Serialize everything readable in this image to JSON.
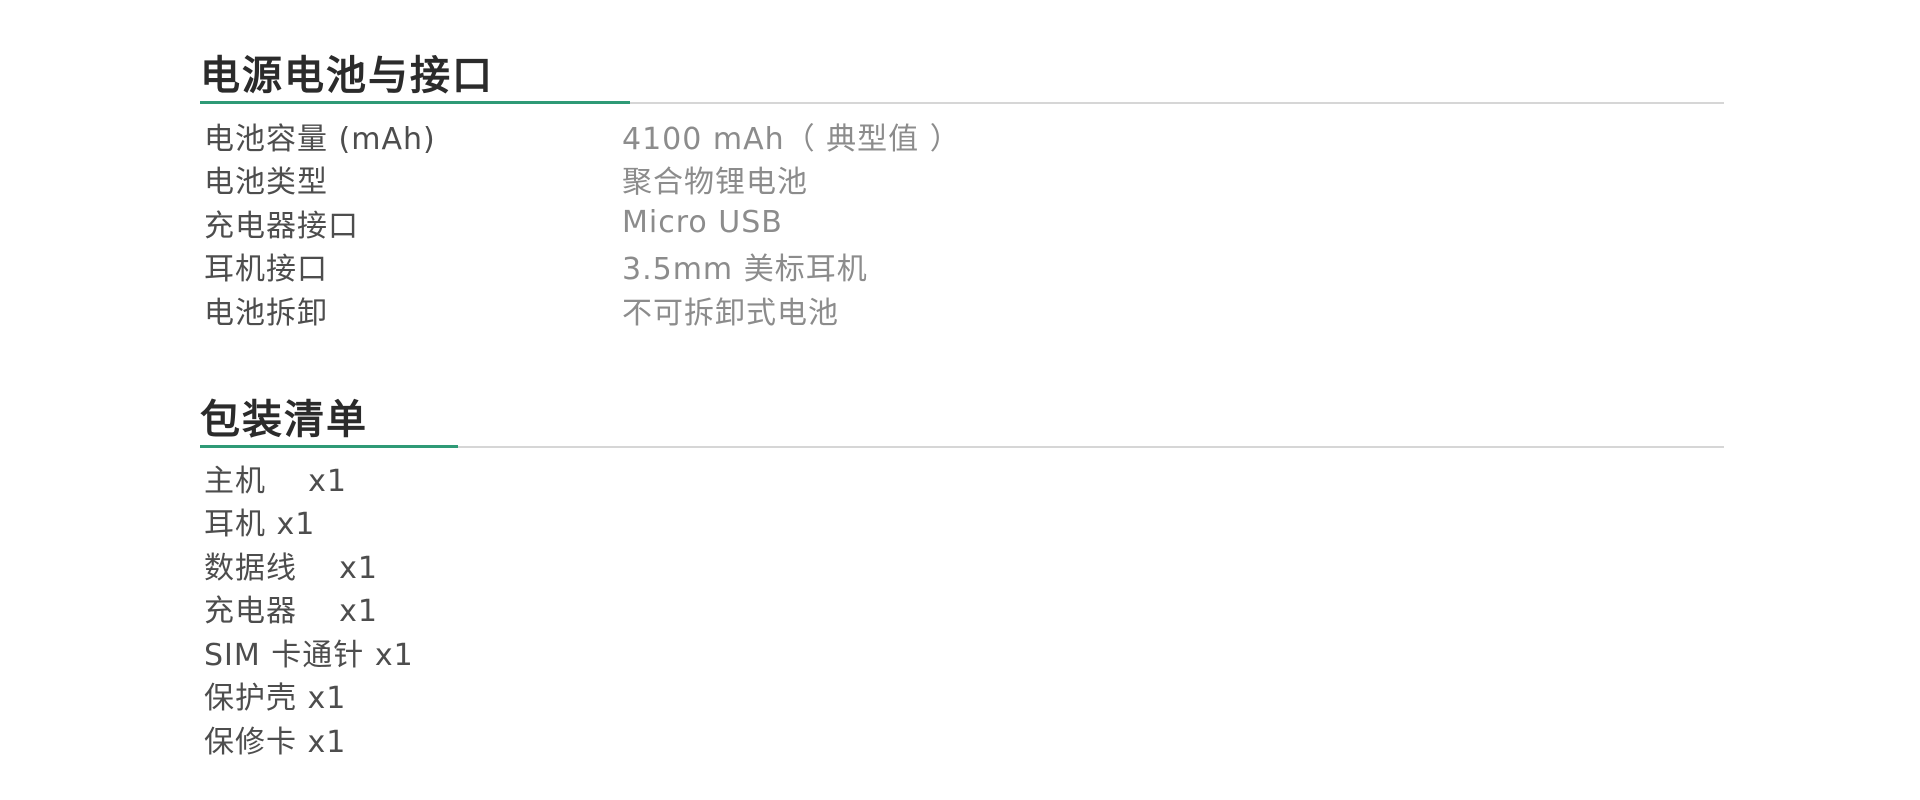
{
  "power": {
    "title": "电源电池与接口",
    "specs": [
      {
        "label": "电池容量 (mAh)",
        "value": "4100 mAh（ 典型值 ）"
      },
      {
        "label": "电池类型",
        "value": "聚合物锂电池"
      },
      {
        "label": "充电器接口",
        "value": "Micro USB"
      },
      {
        "label": "耳机接口",
        "value": "3.5mm 美标耳机"
      },
      {
        "label": "电池拆卸",
        "value": "不可拆卸式电池"
      }
    ]
  },
  "package": {
    "title": "包装清单",
    "items": [
      "主机    x1",
      "耳机 x1",
      "数据线    x1",
      "充电器    x1",
      "SIM 卡通针 x1",
      "保护壳 x1",
      "保修卡 x1"
    ]
  },
  "colors": {
    "accent": "#2f9a76",
    "divider": "#d6d6d6",
    "title_text": "#2b2b2b",
    "label_text": "#4d4d4d",
    "value_text": "#8c8c8c"
  }
}
